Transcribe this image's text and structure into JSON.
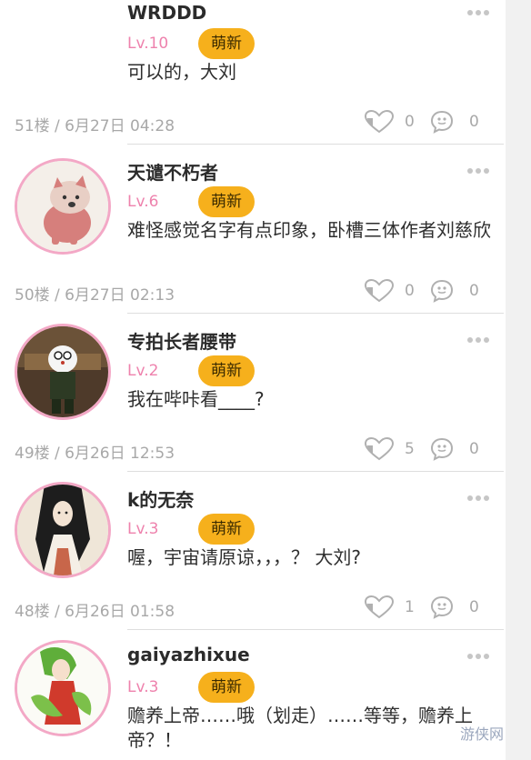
{
  "comments": [
    {
      "username": "WRDDD",
      "level": "Lv.10",
      "badge": "萌新",
      "text": "可以的，大刘",
      "meta": "51楼 / 6月27日 04:28",
      "likes": "0",
      "replies": "0",
      "avatar": "none-visible"
    },
    {
      "username": "天谴不朽者",
      "level": "Lv.6",
      "badge": "萌新",
      "text": "难怪感觉名字有点印象，卧槽三体作者刘慈欣",
      "meta": "50楼 / 6月27日 02:13",
      "likes": "0",
      "replies": "0",
      "avatar": "shiba-dog-avatar"
    },
    {
      "username": "专拍长者腰带",
      "level": "Lv.2",
      "badge": "萌新",
      "text": "我在哔咔看____?",
      "meta": "49楼 / 6月26日 12:53",
      "likes": "5",
      "replies": "0",
      "avatar": "doraemon-figure-avatar"
    },
    {
      "username": "k的无奈",
      "level": "Lv.3",
      "badge": "萌新",
      "text": "喔，宇宙请原谅，，，？ 大刘?",
      "meta": "48楼 / 6月26日 01:58",
      "likes": "1",
      "replies": "0",
      "avatar": "anime-girl-kimono-avatar"
    },
    {
      "username": "gaiyazhixue",
      "level": "Lv.3",
      "badge": "萌新",
      "text": "赡养上帝……哦（划走）……等等，赡养上帝？！",
      "meta": "",
      "likes": "",
      "replies": "",
      "avatar": "anime-girl-green-hair-avatar"
    }
  ],
  "watermark": "游侠网",
  "colors": {
    "level": "#ee82ad",
    "badge": "#f6b01c",
    "avatar_border": "#f3a8c6",
    "meta": "#a8a8a8"
  },
  "icons": {
    "like": "heart-like-icon",
    "reply": "speech-bubble-reply-icon",
    "more": "more-dots-icon"
  }
}
